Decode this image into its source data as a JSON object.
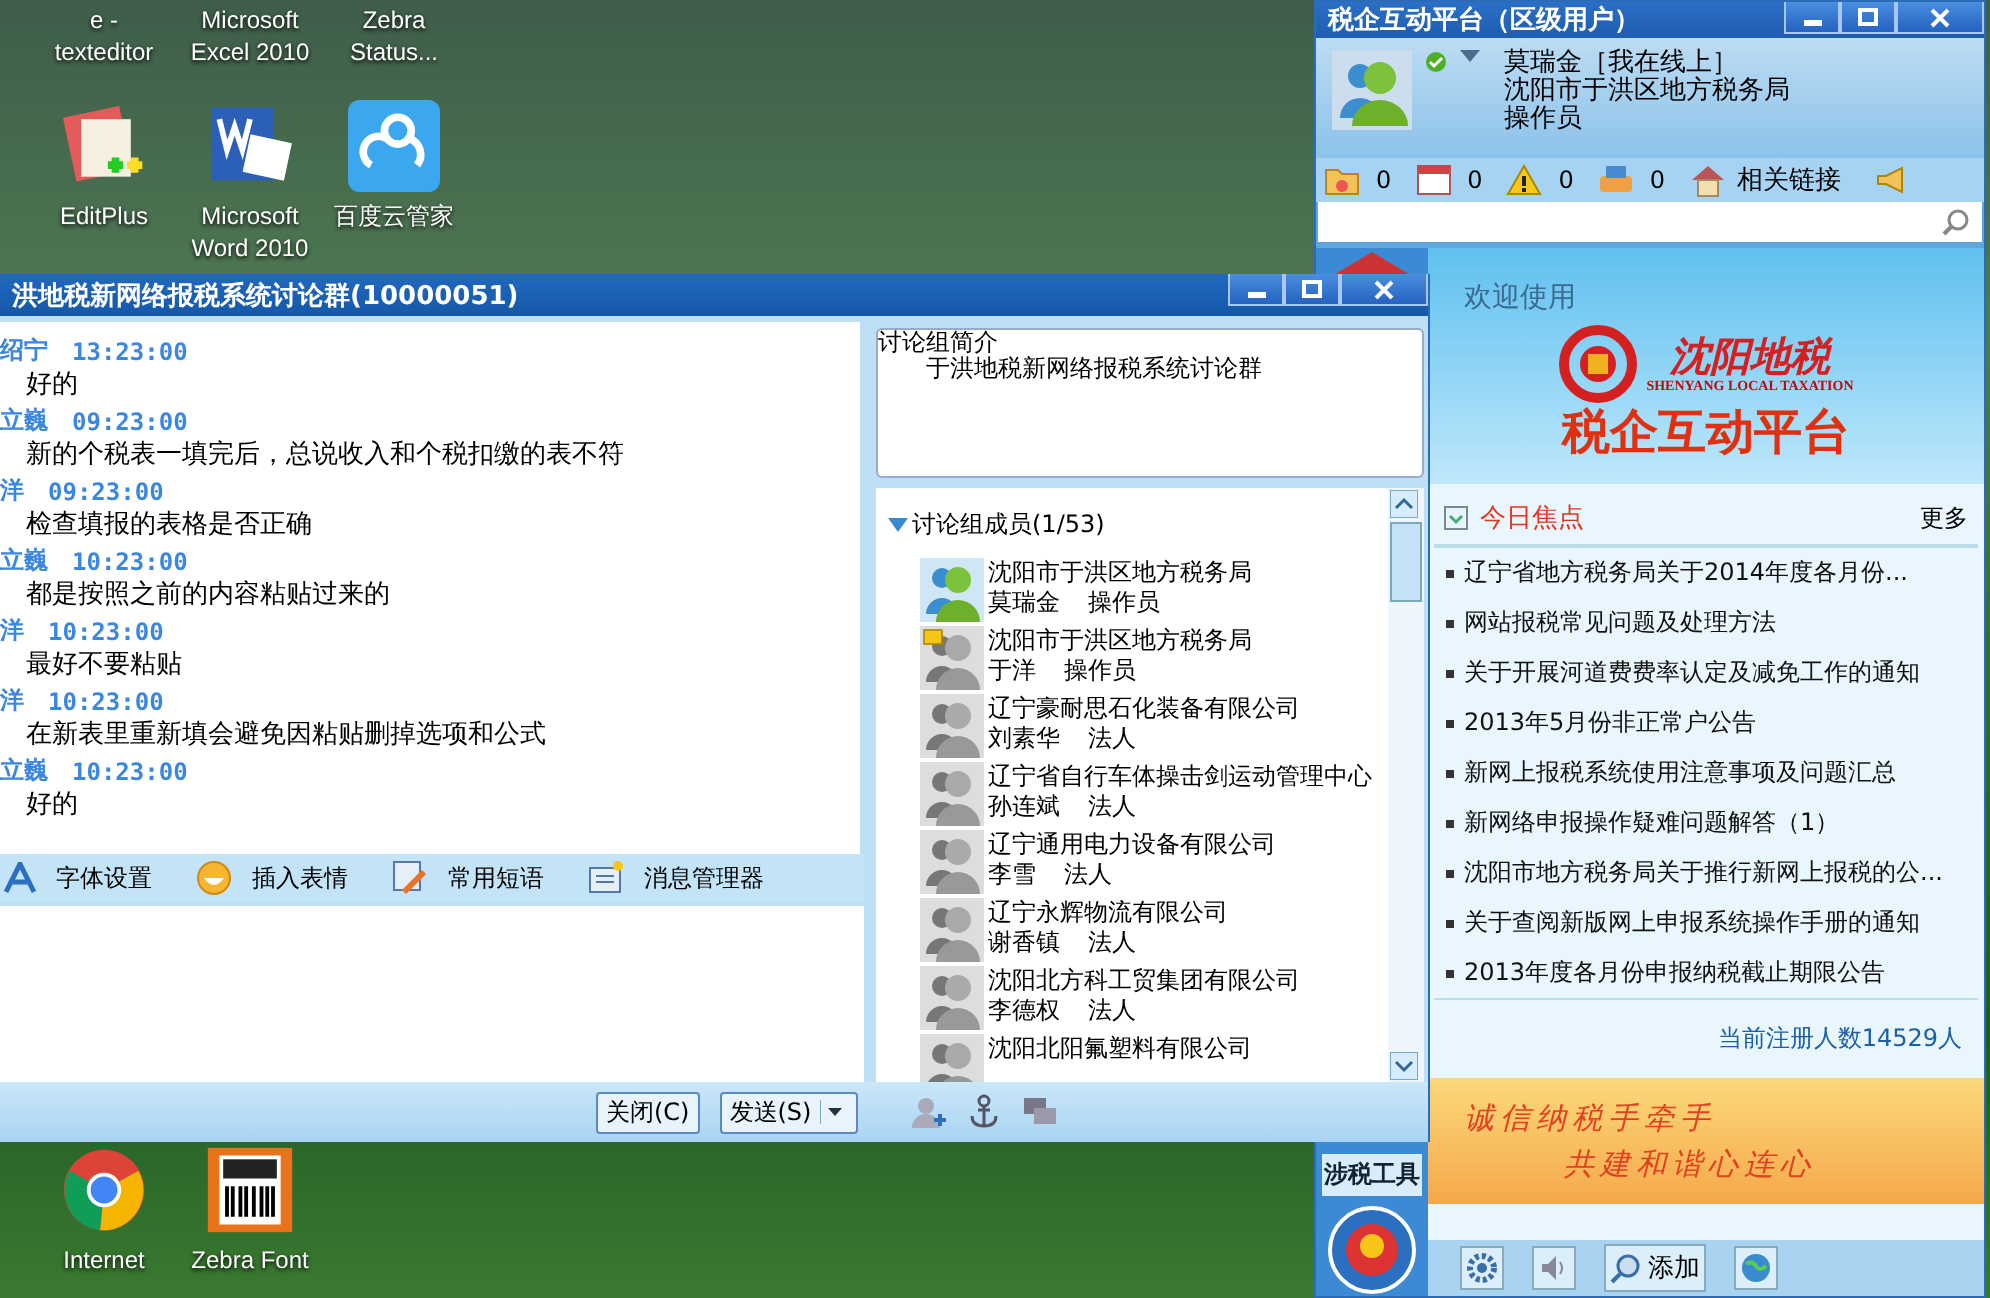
{
  "desktop_icons": {
    "top": [
      {
        "label": "e - texteditor"
      },
      {
        "label": "Microsoft Excel 2010"
      },
      {
        "label": "Zebra Status..."
      }
    ],
    "middle": [
      {
        "label": "EditPlus",
        "kind": "notepad"
      },
      {
        "label": "Microsoft Word 2010",
        "kind": "word"
      },
      {
        "label": "百度云管家",
        "kind": "cloud"
      }
    ],
    "bottom": [
      {
        "label": "Internet",
        "kind": "browser"
      },
      {
        "label": "Zebra Font",
        "kind": "font"
      }
    ]
  },
  "chat_window": {
    "title": "洪地税新网络报税系统讨论群(10000051)",
    "messages": [
      {
        "sender": "绍宁",
        "time": "13:23:00",
        "text": "好的"
      },
      {
        "sender": "立巍",
        "time": "09:23:00",
        "text": "新的个税表一填完后，总说收入和个税扣缴的表不符"
      },
      {
        "sender": "洋",
        "time": "09:23:00",
        "text": "检查填报的表格是否正确"
      },
      {
        "sender": "立巍",
        "time": "10:23:00",
        "text": "都是按照之前的内容粘贴过来的"
      },
      {
        "sender": "洋",
        "time": "10:23:00",
        "text": "最好不要粘贴"
      },
      {
        "sender": "洋",
        "time": "10:23:00",
        "text": "在新表里重新填会避免因粘贴删掉选项和公式"
      },
      {
        "sender": "立巍",
        "time": "10:23:00",
        "text": "好的"
      }
    ],
    "toolbar": [
      {
        "label": "字体设置",
        "kind": "font"
      },
      {
        "label": "插入表情",
        "kind": "smiley"
      },
      {
        "label": "常用短语",
        "kind": "phrases"
      },
      {
        "label": "消息管理器",
        "kind": "messages"
      }
    ],
    "intro": {
      "heading": "讨论组简介",
      "text": "于洪地税新网络报税系统讨论群"
    },
    "members_header": {
      "label": "讨论组成员(1/53)",
      "expanded": true
    },
    "members": [
      {
        "org": "沈阳市于洪区地方税务局",
        "name": "莫瑞金",
        "role": "操作员",
        "online": true,
        "away": false
      },
      {
        "org": "沈阳市于洪区地方税务局",
        "name": "于洋",
        "role": "操作员",
        "online": false,
        "away": true
      },
      {
        "org": "辽宁豪耐思石化装备有限公司",
        "name": "刘素华",
        "role": "法人",
        "online": false,
        "away": false
      },
      {
        "org": "辽宁省自行车体操击剑运动管理中心",
        "name": "孙连斌",
        "role": "法人",
        "online": false,
        "away": false
      },
      {
        "org": "辽宁通用电力设备有限公司",
        "name": "李雪",
        "role": "法人",
        "online": false,
        "away": false
      },
      {
        "org": "辽宁永辉物流有限公司",
        "name": "谢香镇",
        "role": "法人",
        "online": false,
        "away": false
      },
      {
        "org": "沈阳北方科工贸集团有限公司",
        "name": "李德权",
        "role": "法人",
        "online": false,
        "away": false
      },
      {
        "org": "沈阳北阳氟塑料有限公司",
        "online": false,
        "away": false
      }
    ],
    "buttons": [
      {
        "label": "关闭(C)",
        "kind": "plain"
      },
      {
        "label": "发送(S)",
        "kind": "split"
      }
    ],
    "actions": [
      {
        "kind": "person-add"
      },
      {
        "kind": "anchor"
      },
      {
        "kind": "chat"
      }
    ]
  },
  "app_window": {
    "title": "税企互动平台（区级用户）",
    "user": {
      "name": "莫瑞金［我在线上］",
      "org": "沈阳市于洪区地方税务局",
      "role": "操作员",
      "online": true
    },
    "counters": [
      {
        "kind": "folder",
        "count": "0"
      },
      {
        "kind": "calendar",
        "count": "0"
      },
      {
        "kind": "warning",
        "count": "0"
      },
      {
        "kind": "printer",
        "count": "0"
      }
    ],
    "links_label": "相关链接",
    "welcome": "欢迎使用",
    "logo_text": "沈阳地税",
    "logo_subtitle": "SHENYANG LOCAL TAXATION",
    "platform_title": "税企互动平台",
    "news_heading": "今日焦点",
    "more": "更多",
    "news": [
      "辽宁省地方税务局关于2014年度各月份...",
      "网站报税常见问题及处理方法",
      "关于开展河道费费率认定及减免工作的通知",
      "2013年5月份非正常户公告",
      "新网上报税系统使用注意事项及问题汇总",
      "新网络申报操作疑难问题解答（1）",
      "沈阳市地方税务局关于推行新网上报税的公...",
      "关于查阅新版网上申报系统操作手册的通知",
      "2013年度各月份申报纳税截止期限公告"
    ],
    "registered": "当前注册人数14529人",
    "banner": [
      "诚信纳税手牵手",
      "共建和谐心连心"
    ],
    "side_label": "涉税工具",
    "bottom_tools": [
      {
        "kind": "gear"
      },
      {
        "kind": "speaker"
      },
      {
        "kind": "search",
        "label": "添加"
      },
      {
        "kind": "globe"
      }
    ]
  }
}
